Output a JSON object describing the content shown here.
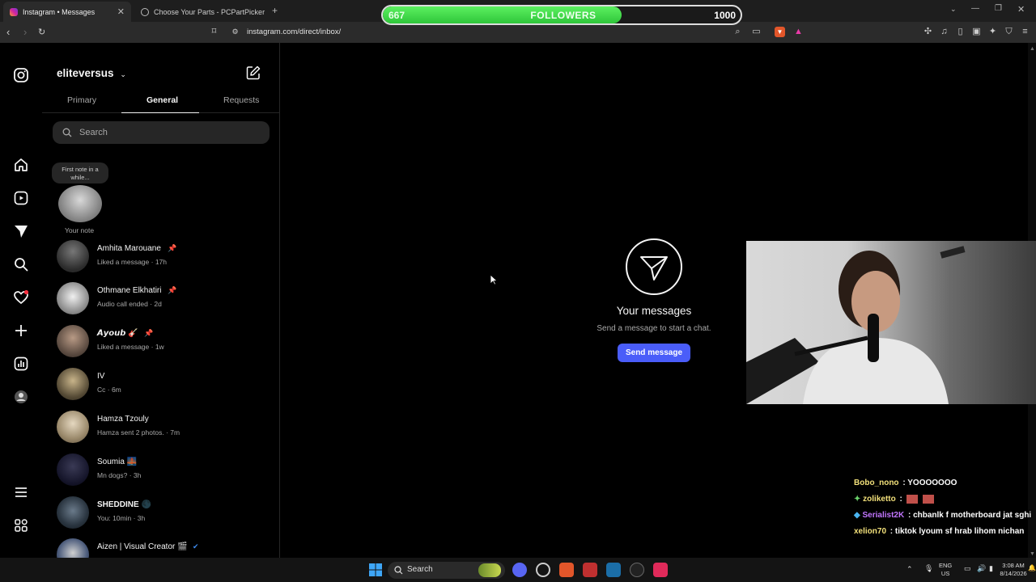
{
  "browser": {
    "tabs": [
      {
        "title": "Instagram • Messages",
        "active": true
      },
      {
        "title": "Choose Your Parts - PCPartPicker",
        "active": false
      }
    ],
    "url": "instagram.com/direct/inbox/"
  },
  "followers_bar": {
    "current": "667",
    "label": "FOLLOWERS",
    "goal": "1000",
    "progress": 0.667,
    "color": "#3ed94a"
  },
  "inbox": {
    "username": "eliteversus",
    "tabs": [
      "Primary",
      "General",
      "Requests"
    ],
    "active_tab": "General",
    "search_placeholder": "Search",
    "note": {
      "bubble": "First note in a while...",
      "label": "Your note"
    },
    "conversations": [
      {
        "name": "Amhita Marouane",
        "pinned": true,
        "subtitle": "Liked a message · 17h"
      },
      {
        "name": "Othmane Elkhatiri",
        "pinned": true,
        "subtitle": "Audio call ended · 2d"
      },
      {
        "name": "𝘼𝙮𝙤𝙪𝙗 🎸",
        "pinned": true,
        "subtitle": "Liked a message · 1w"
      },
      {
        "name": "IV",
        "pinned": false,
        "subtitle": "Cc · 6m"
      },
      {
        "name": "Hamza Tzouly",
        "pinned": false,
        "subtitle": "Hamza sent 2 photos. · 7m"
      },
      {
        "name": "Soumia 🌉",
        "pinned": false,
        "subtitle": "Mn dogs? · 3h"
      },
      {
        "name": "SHEDDINE 🌑",
        "pinned": false,
        "subtitle": "You: 10min · 3h"
      },
      {
        "name": "Aizen | Visual Creator 🎬",
        "pinned": false,
        "subtitle": ""
      }
    ]
  },
  "main": {
    "title": "Your messages",
    "subtitle": "Send a message to start a chat.",
    "button": "Send message",
    "accent": "#4a5df9"
  },
  "stream_chat": [
    {
      "user": "Bobo_nono",
      "message": "YOOOOOOO",
      "color": "#f2e07a"
    },
    {
      "user": "zoliketto",
      "message": "",
      "color": "#f2e07a"
    },
    {
      "user": "Serialist2K",
      "message": "chbanlk f motherboard jat sghi",
      "color": "#c276ff"
    },
    {
      "user": "xelion70",
      "message": "tiktok lyoum sf hrab lihom nichan",
      "color": "#f2e07a"
    }
  ],
  "taskbar": {
    "search": "Search",
    "lang": "ENG",
    "region": "US",
    "time": "3:08 AM",
    "date": "8/14/2026"
  }
}
